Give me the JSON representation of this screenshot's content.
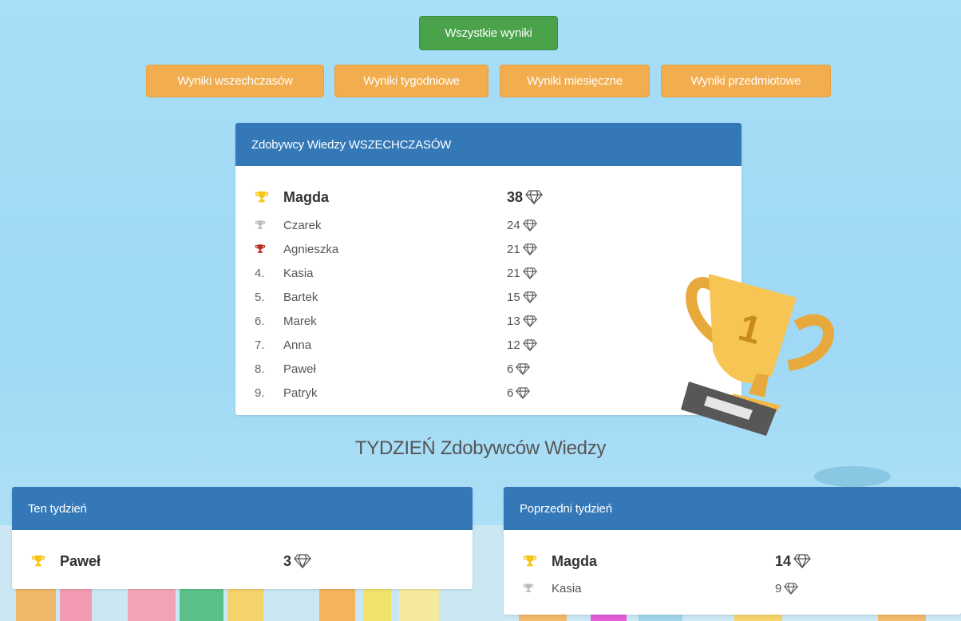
{
  "nav": {
    "all_results": "Wszystkie wyniki",
    "filters": [
      "Wyniki wszechczasów",
      "Wyniki tygodniowe",
      "Wyniki miesięczne",
      "Wyniki przedmiotowe"
    ]
  },
  "alltime": {
    "header": "Zdobywcy Wiedzy WSZECHCZASÓW",
    "rows": [
      {
        "rank": "gold-trophy-icon",
        "name": "Magda",
        "score": "38"
      },
      {
        "rank": "silver-trophy-icon",
        "name": "Czarek",
        "score": "24"
      },
      {
        "rank": "bronze-trophy-icon",
        "name": "Agnieszka",
        "score": "21"
      },
      {
        "rank": "4.",
        "name": "Kasia",
        "score": "21"
      },
      {
        "rank": "5.",
        "name": "Bartek",
        "score": "15"
      },
      {
        "rank": "6.",
        "name": "Marek",
        "score": "13"
      },
      {
        "rank": "7.",
        "name": "Anna",
        "score": "12"
      },
      {
        "rank": "8.",
        "name": "Paweł",
        "score": "6"
      },
      {
        "rank": "9.",
        "name": "Patryk",
        "score": "6"
      }
    ]
  },
  "week_title": "TYDZIEŃ Zdobywców Wiedzy",
  "this_week": {
    "header": "Ten tydzień",
    "rows": [
      {
        "name": "Paweł",
        "score": "3"
      }
    ]
  },
  "prev_week": {
    "header": "Poprzedni tydzień",
    "rows": [
      {
        "name": "Magda",
        "score": "14"
      },
      {
        "name": "Kasia",
        "score": "9"
      }
    ]
  },
  "colors": {
    "accent_blue": "#3478b8",
    "green": "#4aa34a",
    "orange": "#f2ad4e",
    "gold": "#f5c518",
    "silver": "#bdbdbd",
    "bronze": "#b52a24"
  }
}
